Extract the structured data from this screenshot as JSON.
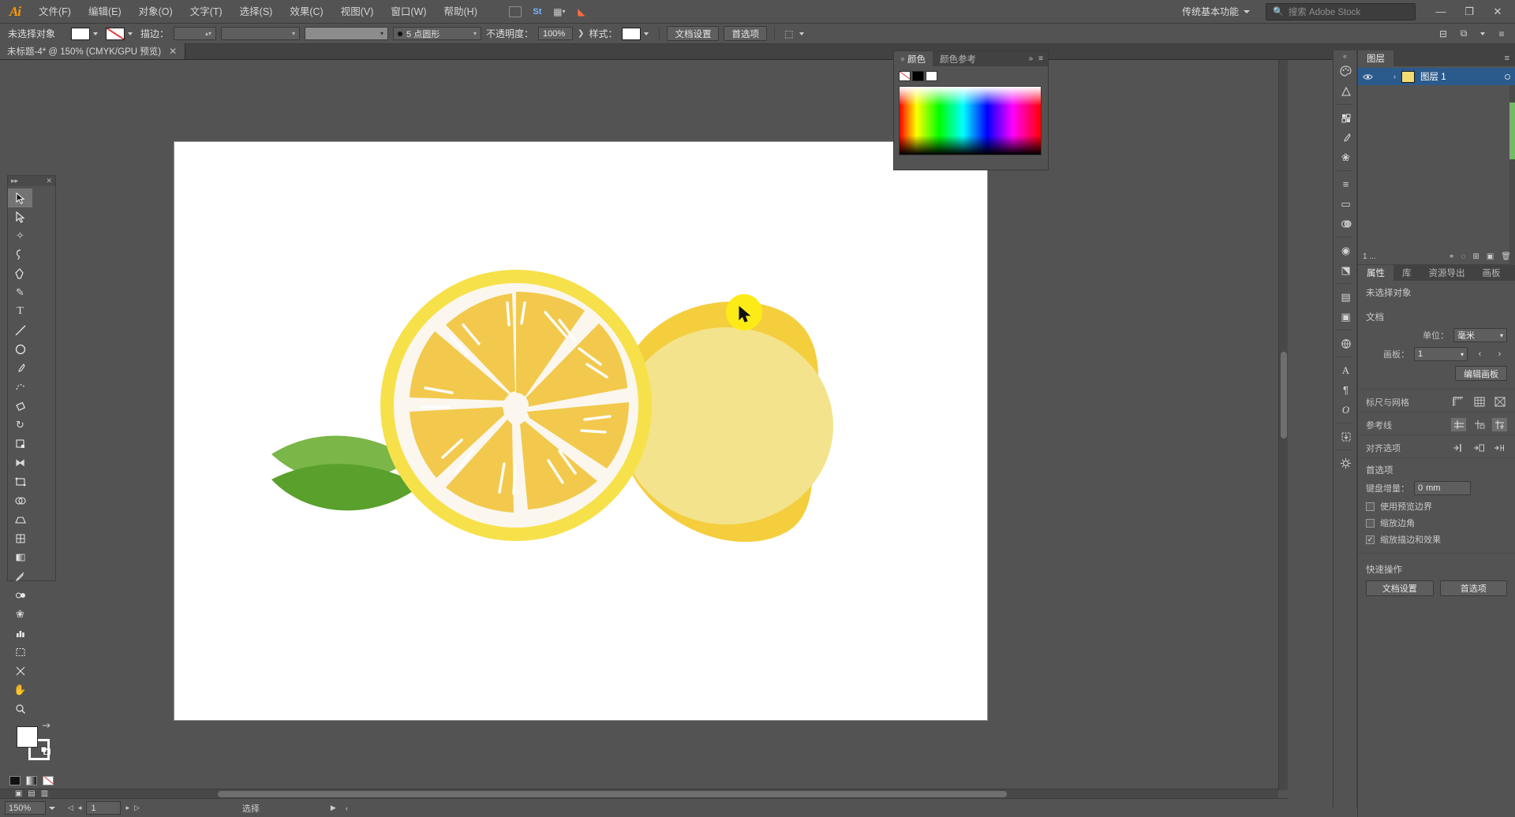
{
  "app": {
    "name": "Adobe Illustrator",
    "logo_text": "Ai"
  },
  "menubar": {
    "items": [
      "文件(F)",
      "编辑(E)",
      "对象(O)",
      "文字(T)",
      "选择(S)",
      "效果(C)",
      "视图(V)",
      "窗口(W)",
      "帮助(H)"
    ],
    "workspace": "传统基本功能",
    "search_placeholder": "搜索 Adobe Stock",
    "window_buttons": {
      "minimize": "—",
      "maximize": "❐",
      "close": "✕"
    },
    "stock_icon": "search-icon",
    "bridge_icon": "Br",
    "stock_label": "St"
  },
  "controlbar": {
    "selection_label": "未选择对象",
    "stroke_label": "描边：",
    "stroke_weight": "",
    "brush_label": "5 点圆形",
    "opacity_label": "不透明度：",
    "opacity_value": "100%",
    "style_label": "样式：",
    "doc_setup_button": "文档设置",
    "preferences_button": "首选项",
    "align_icon": "align-icon",
    "arrange_icon": "arrange-icon",
    "transform_icon": "transform-icon",
    "menu_icon": "panel-menu-icon"
  },
  "document_tab": {
    "title": "未标题-4* @ 150% (CMYK/GPU 预览)",
    "close": "✕"
  },
  "toolbar": {
    "grip": "▸▸",
    "close": "✕",
    "tools": [
      {
        "name": "selection-tool",
        "glyph": "➤",
        "active": true
      },
      {
        "name": "direct-selection-tool",
        "glyph": "➢",
        "active": false
      },
      {
        "name": "magic-wand-tool",
        "glyph": "✦",
        "active": false
      },
      {
        "name": "lasso-tool",
        "glyph": "◠",
        "active": false
      },
      {
        "name": "pen-tool",
        "glyph": "✒",
        "active": false
      },
      {
        "name": "curvature-tool",
        "glyph": "✐",
        "active": false
      },
      {
        "name": "type-tool",
        "glyph": "T",
        "active": false
      },
      {
        "name": "line-segment-tool",
        "glyph": "╱",
        "active": false
      },
      {
        "name": "ellipse-tool",
        "glyph": "◯",
        "active": false
      },
      {
        "name": "paintbrush-tool",
        "glyph": "🖌",
        "active": false
      },
      {
        "name": "shaper-tool",
        "glyph": "◌",
        "active": false
      },
      {
        "name": "eraser-tool",
        "glyph": "◆",
        "active": false
      },
      {
        "name": "rotate-tool",
        "glyph": "↻",
        "active": false
      },
      {
        "name": "scale-tool",
        "glyph": "⤢",
        "active": false
      },
      {
        "name": "width-tool",
        "glyph": "⧓",
        "active": false
      },
      {
        "name": "free-transform-tool",
        "glyph": "✥",
        "active": false
      },
      {
        "name": "shape-builder-tool",
        "glyph": "⊕",
        "active": false
      },
      {
        "name": "perspective-grid-tool",
        "glyph": "▱",
        "active": false
      },
      {
        "name": "mesh-tool",
        "glyph": "▦",
        "active": false
      },
      {
        "name": "gradient-tool",
        "glyph": "▤",
        "active": false
      },
      {
        "name": "eyedropper-tool",
        "glyph": "⚲",
        "active": false
      },
      {
        "name": "blend-tool",
        "glyph": "◑",
        "active": false
      },
      {
        "name": "symbol-sprayer-tool",
        "glyph": "✾",
        "active": false
      },
      {
        "name": "column-graph-tool",
        "glyph": "▥",
        "active": false
      },
      {
        "name": "artboard-tool",
        "glyph": "▣",
        "active": false
      },
      {
        "name": "slice-tool",
        "glyph": "✂",
        "active": false
      },
      {
        "name": "hand-tool",
        "glyph": "✋",
        "active": false
      },
      {
        "name": "zoom-tool",
        "glyph": "🔍",
        "active": false
      }
    ],
    "fill_color": "#ffffff",
    "stroke_color": "#ffffff",
    "swap_icon": "swap-fill-stroke-icon",
    "default_icon": "default-colors-icon",
    "modes": [
      "color-mode-icon",
      "gradient-mode-icon",
      "none-mode-icon"
    ],
    "screen_mode": "screen-mode-icon"
  },
  "canvas": {
    "artboard_bg": "#ffffff",
    "cursor_color": "#fdeb17",
    "artwork_name": "lemon-illustration",
    "colors": {
      "peel": "#f5ce3e",
      "peel_light": "#f0e189",
      "rind": "#f7e14a",
      "pulp": "#f2c94c",
      "flesh_bg": "#f9f5ef",
      "leaf_dark": "#5aa02c",
      "leaf_light": "#7ab648",
      "highlight": "#ffffff"
    }
  },
  "colorpanel": {
    "tabs": [
      {
        "label": "颜色",
        "active": true
      },
      {
        "label": "颜色参考",
        "active": false
      }
    ],
    "collapse_icon": "double-chevron-icon",
    "menu_icon": "panel-menu-icon",
    "swatches": [
      "none",
      "black",
      "white"
    ]
  },
  "rightdock": {
    "collapse_icon": "double-chevron-icon",
    "icons": [
      {
        "name": "color-panel-icon",
        "glyph": "◕"
      },
      {
        "name": "color-guide-icon",
        "glyph": "◔"
      },
      {
        "name": "swatches-panel-icon",
        "glyph": "▦"
      },
      {
        "name": "brushes-panel-icon",
        "glyph": "🖌"
      },
      {
        "name": "symbols-panel-icon",
        "glyph": "❀"
      },
      {
        "name": "align-panel-icon",
        "glyph": "≡"
      },
      {
        "name": "transform-panel-icon",
        "glyph": "▭"
      },
      {
        "name": "pathfinder-panel-icon",
        "glyph": "◓"
      },
      {
        "name": "appearance-panel-icon",
        "glyph": "◉"
      },
      {
        "name": "graphic-styles-panel-icon",
        "glyph": "⬔"
      },
      {
        "name": "layers-panel-icon",
        "glyph": "▤"
      },
      {
        "name": "artboards-panel-icon",
        "glyph": "▣"
      },
      {
        "name": "links-panel-icon",
        "glyph": "🔗"
      },
      {
        "name": "character-panel-icon",
        "glyph": "A"
      },
      {
        "name": "paragraph-panel-icon",
        "glyph": "¶"
      },
      {
        "name": "opentype-panel-icon",
        "glyph": "𝑂"
      },
      {
        "name": "asset-export-panel-icon",
        "glyph": "⤓"
      },
      {
        "name": "properties-panel-icon",
        "glyph": "⚙"
      }
    ]
  },
  "layers_panel": {
    "title": "图层",
    "menu_icon": "panel-menu-icon",
    "rows": [
      {
        "name": "图层 1",
        "visible": true,
        "selected": true,
        "expand": "›"
      }
    ],
    "footer": {
      "count_label": "1 ...",
      "buttons": [
        {
          "name": "locate-object-button",
          "glyph": "⌖"
        },
        {
          "name": "make-clipping-mask-button",
          "glyph": "◌"
        },
        {
          "name": "create-sublayer-button",
          "glyph": "⊞"
        },
        {
          "name": "create-new-layer-button",
          "glyph": "▣"
        },
        {
          "name": "delete-selection-button",
          "glyph": "🗑"
        }
      ]
    }
  },
  "properties_panel": {
    "tabs": [
      {
        "label": "属性",
        "active": true
      },
      {
        "label": "库",
        "active": false
      },
      {
        "label": "资源导出",
        "active": false
      },
      {
        "label": "画板",
        "active": false
      }
    ],
    "no_selection": "未选择对象",
    "document": {
      "title": "文档",
      "unit_label": "单位：",
      "unit_value": "毫米",
      "artboard_label": "画板：",
      "artboard_value": "1",
      "edit_artboards_button": "编辑画板"
    },
    "rulers_grid": {
      "label": "标尺与网格",
      "icons": [
        "show-rulers-icon",
        "show-grid-icon",
        "show-transparency-grid-icon"
      ]
    },
    "guides": {
      "label": "参考线",
      "icons": [
        "show-guides-icon",
        "lock-guides-icon",
        "smart-guides-icon"
      ]
    },
    "align_options": {
      "label": "对齐选项",
      "icons": [
        "snap-to-point-icon",
        "snap-to-grid-icon",
        "snap-to-pixel-icon"
      ]
    },
    "preferences": {
      "title": "首选项",
      "keyboard_increment_label": "键盘增量：",
      "keyboard_increment_value": "0",
      "keyboard_increment_unit": "mm",
      "checkboxes": [
        {
          "label": "使用预览边界",
          "checked": false
        },
        {
          "label": "缩放边角",
          "checked": false
        },
        {
          "label": "缩放描边和效果",
          "checked": true
        }
      ]
    },
    "quick_actions": {
      "title": "快速操作",
      "buttons": [
        "文档设置",
        "首选项"
      ]
    }
  },
  "statusbar": {
    "zoom_value": "150%",
    "page_value": "1",
    "status_text": "选择",
    "prev_arrow": "◂",
    "next_arrow": "▸",
    "first_arrow": "◁",
    "last_arrow": "▷"
  }
}
